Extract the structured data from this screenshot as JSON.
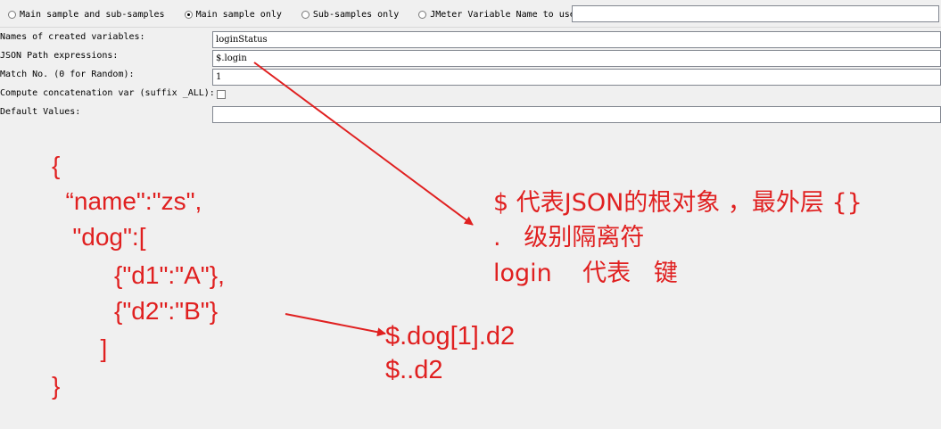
{
  "scope": {
    "options": [
      {
        "label": "Main sample and sub-samples",
        "checked": false
      },
      {
        "label": "Main sample only",
        "checked": true
      },
      {
        "label": "Sub-samples only",
        "checked": false
      },
      {
        "label": "JMeter Variable Name to use",
        "checked": false
      }
    ],
    "variable_name_value": ""
  },
  "fields": {
    "names_label": "Names of created variables:",
    "names_value": "loginStatus",
    "json_path_label": "JSON Path expressions:",
    "json_path_value": "$.login",
    "match_no_label": "Match No. (0 for Random):",
    "match_no_value": "1",
    "concat_label": "Compute concatenation var (suffix _ALL):",
    "concat_checked": false,
    "default_label": "Default Values:",
    "default_value": ""
  },
  "annotation": {
    "json_example": [
      "{",
      "  “name\":\"zs\",",
      "   \"dog\":[",
      "         {\"d1\":\"A\"},",
      "         {\"d2\":\"B\"}",
      "       ]",
      "}"
    ],
    "explanation": [
      "$ 代表JSON的根对象 ，最外层 {}",
      ".   级别隔离符",
      "login    代表   键"
    ],
    "path_examples": [
      "$.dog[1].d2",
      "$..d2"
    ],
    "color": "#e02020"
  }
}
